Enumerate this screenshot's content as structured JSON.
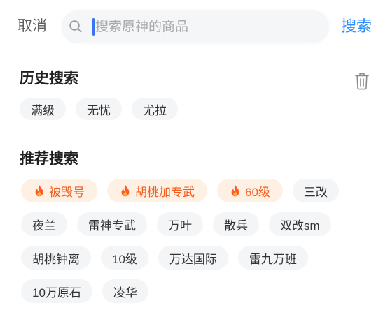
{
  "header": {
    "cancel_label": "取消",
    "search": {
      "icon": "search-icon",
      "placeholder": "搜索原神的商品",
      "value": ""
    },
    "search_button_label": "搜索"
  },
  "history": {
    "title": "历史搜索",
    "clear_icon": "trash-icon",
    "items": [
      {
        "label": "满级"
      },
      {
        "label": "无忧"
      },
      {
        "label": "尤拉"
      }
    ]
  },
  "recommended": {
    "title": "推荐搜索",
    "hot_icon": "fire-icon",
    "rows": [
      [
        {
          "label": "被毁号",
          "hot": true
        },
        {
          "label": "胡桃加专武",
          "hot": true
        },
        {
          "label": "60级",
          "hot": true
        },
        {
          "label": "三改",
          "hot": false
        }
      ],
      [
        {
          "label": "夜兰",
          "hot": false
        },
        {
          "label": "雷神专武",
          "hot": false
        },
        {
          "label": "万叶",
          "hot": false
        },
        {
          "label": "散兵",
          "hot": false
        },
        {
          "label": "双改sm",
          "hot": false
        }
      ],
      [
        {
          "label": "胡桃钟离",
          "hot": false
        },
        {
          "label": "10级",
          "hot": false
        },
        {
          "label": "万达国际",
          "hot": false
        },
        {
          "label": "雷九万班",
          "hot": false
        }
      ],
      [
        {
          "label": "10万原石",
          "hot": false
        },
        {
          "label": "凌华",
          "hot": false
        }
      ]
    ]
  },
  "colors": {
    "accent": "#2b8cff",
    "cursor": "#3a72f5",
    "hot_text": "#f25c1e",
    "hot_bg": "#fff0e4",
    "chip_bg": "#f4f5f7",
    "chip_text": "#333333"
  }
}
